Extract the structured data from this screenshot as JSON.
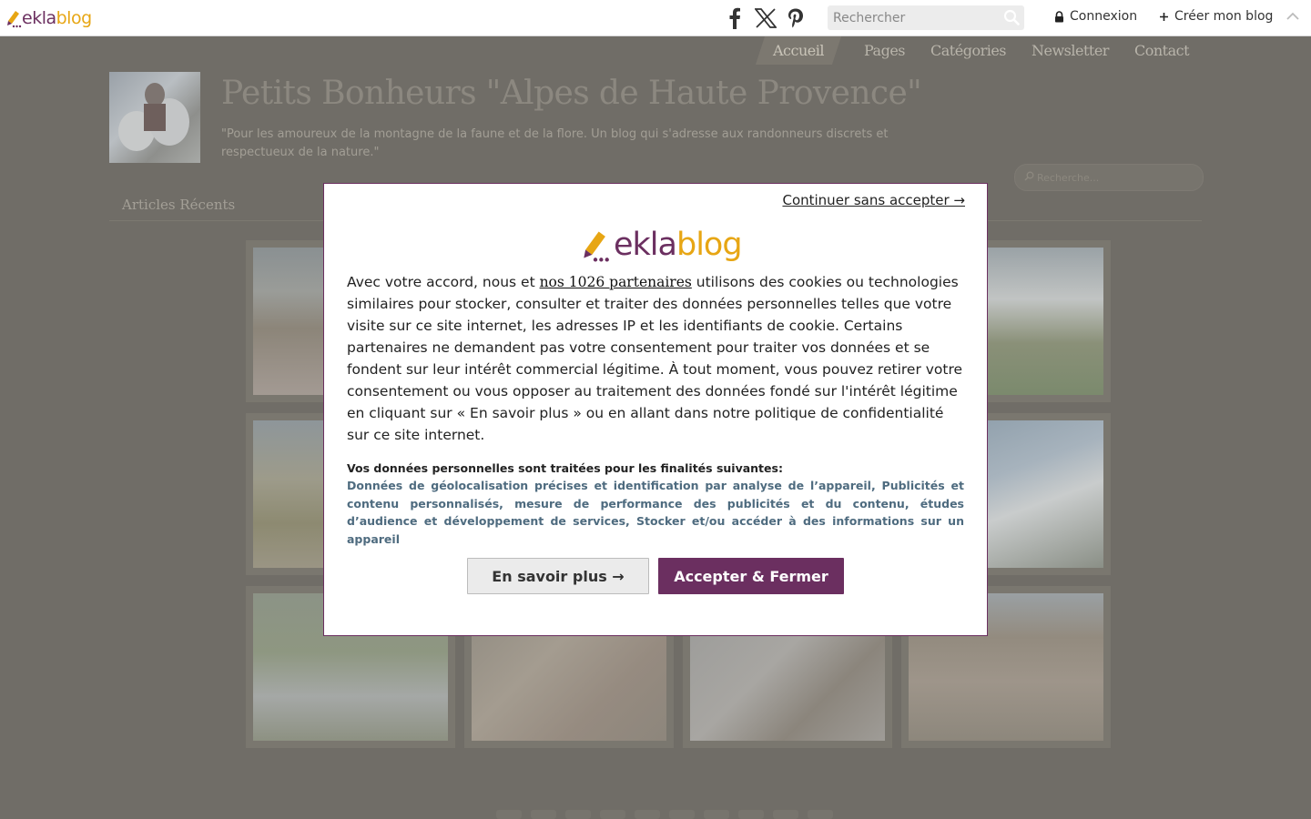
{
  "topbar": {
    "logo_text_1": "ekla",
    "logo_text_2": "blog",
    "social": [
      {
        "icon": "facebook-icon"
      },
      {
        "icon": "x-icon"
      },
      {
        "icon": "pinterest-icon"
      }
    ],
    "search_placeholder": "Rechercher",
    "login_label": "Connexion",
    "create_label": "Créer mon blog"
  },
  "blog": {
    "nav": [
      "Accueil",
      "Pages",
      "Catégories",
      "Newsletter",
      "Contact"
    ],
    "title": "Petits Bonheurs \"Alpes de Haute Provence\"",
    "description": "\"Pour les amoureux de la montagne de la faune et de la flore. Un blog qui s'adresse aux randonneurs discrets et respectueux de la nature.\"",
    "search_placeholder": "Recherche...",
    "recent_label": "Articles Récents",
    "tiles": [
      {
        "scene": "lavender-field"
      },
      {
        "scene": "snowy-peaks-lake"
      },
      {
        "scene": "green-valley"
      },
      {
        "scene": "snowy-mountain"
      },
      {
        "scene": "mountain-stream"
      },
      {
        "scene": "village-rooftops"
      },
      {
        "scene": "marmot-on-rock"
      },
      {
        "scene": "town-aerial"
      }
    ]
  },
  "consent": {
    "continue_label": "Continuer sans accepter →",
    "logo_text_1": "ekla",
    "logo_text_2": "blog",
    "text_before": "Avec votre accord, nous et ",
    "partners_link": "nos 1026 partenaires",
    "text_after": " utilisons des cookies ou technologies similaires pour stocker, consulter et traiter des données personnelles telles que votre visite sur ce site internet, les adresses IP et les identifiants de cookie. Certains partenaires ne demandent pas votre consentement pour traiter vos données et se fondent sur leur intérêt commercial légitime. À tout moment, vous pouvez retirer votre consentement ou vous opposer au traitement des données fondé sur l'intérêt légitime en cliquant sur « En savoir plus » ou en allant dans notre politique de confidentialité sur ce site internet.",
    "purposes_title": "Vos données personnelles sont traitées pour les finalités suivantes:",
    "purposes_text": "Données de géolocalisation précises et identification par analyse de l’appareil, Publicités et contenu personnalisés, mesure de performance des publicités et du contenu, études d’audience et développement de services, Stocker et/ou accéder à des informations sur un appareil",
    "more_button": "En savoir plus →",
    "accept_button": "Accepter & Fermer"
  },
  "colors": {
    "brand_purple": "#6b2f60",
    "brand_yellow": "#e7a614",
    "purposes_blue": "#4e6b7f"
  }
}
